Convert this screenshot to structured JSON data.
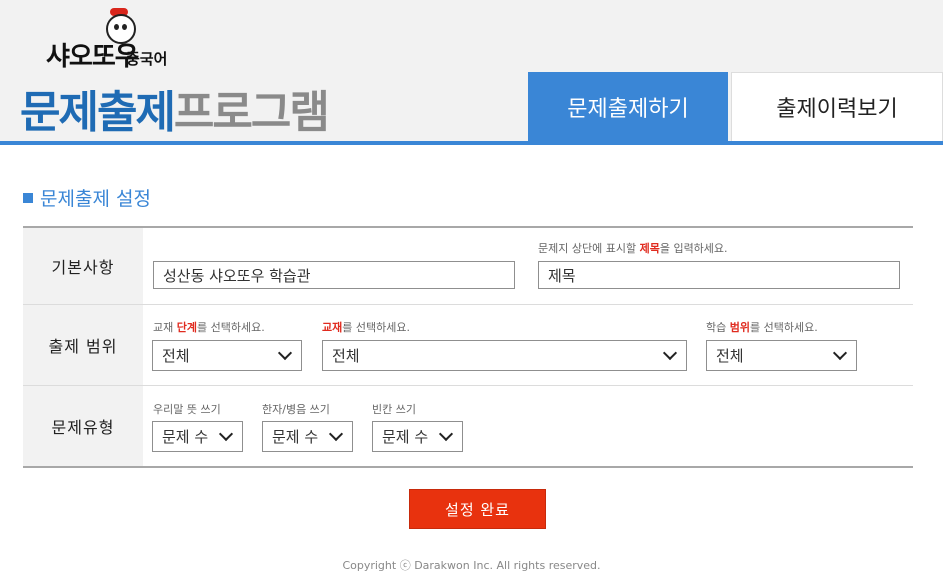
{
  "brand": {
    "name": "샤오또우",
    "sub": "중국어",
    "accent": "#d9261c"
  },
  "app_title": {
    "part1": "문제출제",
    "part2": "프로그램"
  },
  "tabs": [
    {
      "label": "문제출제하기",
      "active": true
    },
    {
      "label": "출제이력보기",
      "active": false
    }
  ],
  "section_title": "문제출제 설정",
  "form": {
    "basic": {
      "label": "기본사항",
      "school_value": "성산동 샤오또우 학습관",
      "title_hint_pre": "문제지 상단에 표시할 ",
      "title_hint_hl": "제목",
      "title_hint_post": "을 입력하세요.",
      "title_value": "제목"
    },
    "scope": {
      "label": "출제 범위",
      "level_hint_pre": "교재 ",
      "level_hint_hl": "단계",
      "level_hint_post": "를 선택하세요.",
      "level_value": "전체",
      "book_hint_hl": "교재",
      "book_hint_post": "를 선택하세요.",
      "book_value": "전체",
      "range_hint_pre": "학습 ",
      "range_hint_hl": "범위",
      "range_hint_post": "를 선택하세요.",
      "range_value": "전체"
    },
    "types": {
      "label": "문제유형",
      "items": [
        {
          "label": "우리말 뜻 쓰기",
          "value": "문제 수"
        },
        {
          "label": "한자/병음 쓰기",
          "value": "문제 수"
        },
        {
          "label": "빈칸 쓰기",
          "value": "문제 수"
        }
      ]
    }
  },
  "submit_label": "설정 완료",
  "footer": "Copyright ⓒ Darakwon Inc. All rights reserved.",
  "colors": {
    "primary": "#3a86d6",
    "action": "#e8320e",
    "highlight": "#e02b1f"
  }
}
